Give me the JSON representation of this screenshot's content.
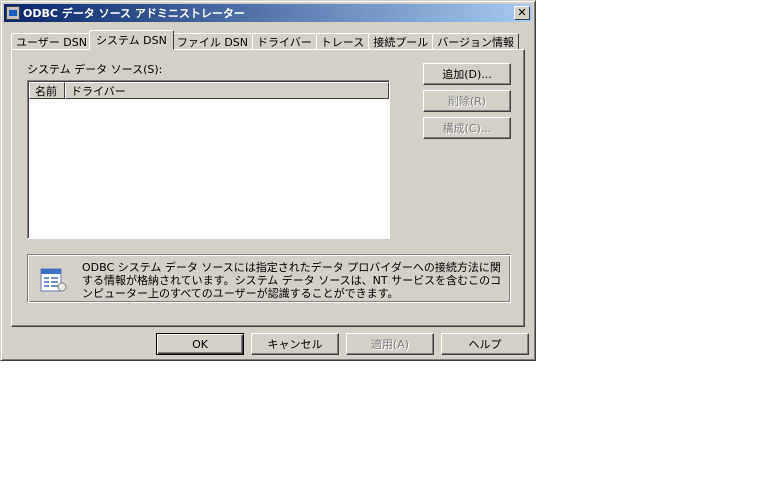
{
  "window": {
    "title": "ODBC データ ソース アドミニストレーター",
    "close_glyph": "✕"
  },
  "tabs": [
    {
      "label": "ユーザー DSN",
      "active": false
    },
    {
      "label": "システム DSN",
      "active": true
    },
    {
      "label": "ファイル DSN",
      "active": false
    },
    {
      "label": "ドライバー",
      "active": false
    },
    {
      "label": "トレース",
      "active": false
    },
    {
      "label": "接続プール",
      "active": false
    },
    {
      "label": "バージョン情報",
      "active": false
    }
  ],
  "panel": {
    "section_label": "システム データ ソース(S):",
    "columns": {
      "name": "名前",
      "driver": "ドライバー"
    },
    "buttons": {
      "add": "追加(D)...",
      "remove": "削除(R)",
      "configure": "構成(C)..."
    },
    "info_icon": "datasource-info-icon",
    "info_text": "ODBC システム データ ソースには指定されたデータ プロバイダーへの接続方法に関する情報が格納されています。システム データ ソースは、NT サービスを含むこのコンピューター上のすべてのユーザーが認識することができます。"
  },
  "footer": {
    "ok": "OK",
    "cancel": "キャンセル",
    "apply": "適用(A)",
    "help": "ヘルプ"
  },
  "colors": {
    "face": "#d4d0c8",
    "title_start": "#0a246a",
    "title_end": "#a6caf0",
    "disabled_text": "#808080"
  }
}
